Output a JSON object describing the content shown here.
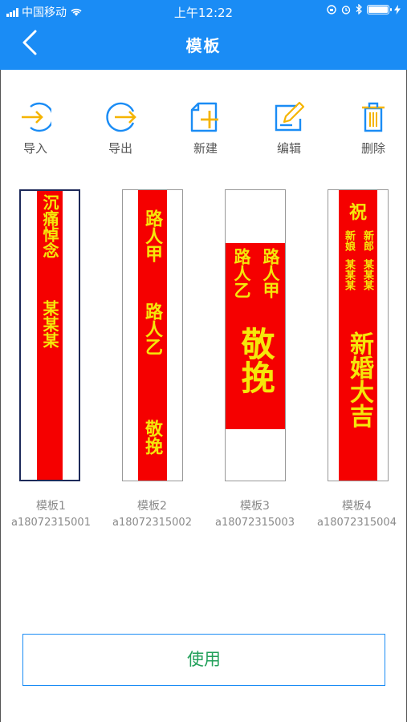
{
  "status_bar": {
    "carrier": "中国移动",
    "time": "上午12:22"
  },
  "nav": {
    "title": "模板"
  },
  "toolbar": [
    {
      "label": "导入",
      "icon": "import-icon"
    },
    {
      "label": "导出",
      "icon": "export-icon"
    },
    {
      "label": "新建",
      "icon": "new-file-icon"
    },
    {
      "label": "编辑",
      "icon": "edit-icon"
    },
    {
      "label": "删除",
      "icon": "delete-icon"
    }
  ],
  "templates": [
    {
      "name": "模板1",
      "id": "a18072315001",
      "selected": true,
      "text_main": "沉痛悼念",
      "text_sub": "某某某"
    },
    {
      "name": "模板2",
      "id": "a18072315002",
      "selected": false,
      "text_a": "路人甲",
      "text_b": "路人乙",
      "text_c": "敬挽"
    },
    {
      "name": "模板3",
      "id": "a18072315003",
      "selected": false,
      "text_col_right": "路人甲",
      "text_col_left": "路人乙",
      "text_big": "敬挽"
    },
    {
      "name": "模板4",
      "id": "a18072315004",
      "selected": false,
      "text_top": "祝",
      "col_right_top": "新郎",
      "col_right_bottom": "某某某",
      "col_left_top": "新娘",
      "col_left_bottom": "某某某",
      "text_big": "新婚大吉"
    }
  ],
  "use_button": {
    "label": "使用"
  },
  "colors": {
    "accent": "#1a8cf5",
    "strip_red": "#f50000",
    "strip_text": "#f5e70a",
    "icon_yellow": "#f5b400",
    "icon_blue": "#1a8cf5",
    "button_text": "#22a05a"
  }
}
